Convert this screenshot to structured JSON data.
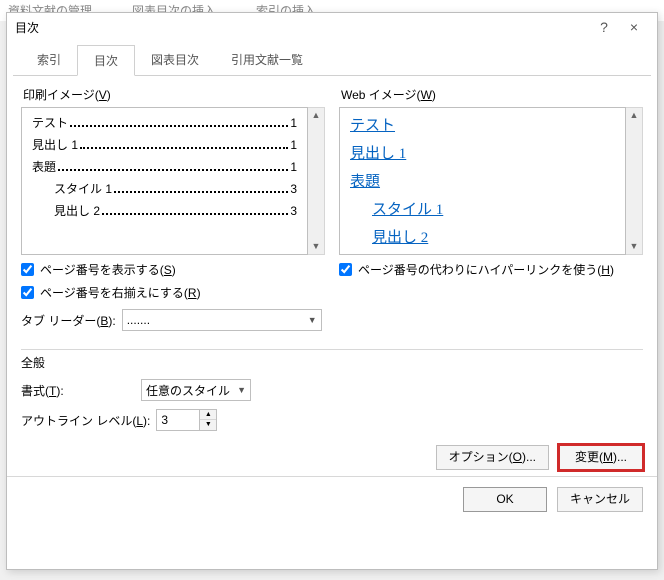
{
  "bg": {
    "a": "資料文献の管理",
    "b": "図表目次の挿入",
    "c": "索引の挿入"
  },
  "titlebar": {
    "title": "目次",
    "help": "?",
    "close": "×"
  },
  "tabs": {
    "t0": "索引",
    "t1": "目次",
    "t2": "図表目次",
    "t3": "引用文献一覧"
  },
  "print": {
    "label_pre": "印刷イメージ(",
    "label_key": "V",
    "label_post": ")",
    "lines": [
      {
        "text": "テスト",
        "page": "1",
        "indent": 0
      },
      {
        "text": "見出し 1",
        "page": "1",
        "indent": 0
      },
      {
        "text": "表題",
        "page": "1",
        "indent": 0
      },
      {
        "text": "スタイル 1",
        "page": "3",
        "indent": 1
      },
      {
        "text": "見出し 2",
        "page": "3",
        "indent": 1
      }
    ]
  },
  "web": {
    "label_pre": "Web イメージ(",
    "label_key": "W",
    "label_post": ")",
    "lines": [
      {
        "text": "テスト",
        "indent": 0
      },
      {
        "text": "見出し 1",
        "indent": 0
      },
      {
        "text": "表題",
        "indent": 0
      },
      {
        "text": "スタイル 1",
        "indent": 1
      },
      {
        "text": "見出し 2",
        "indent": 1
      }
    ]
  },
  "checks": {
    "show_pg_pre": "ページ番号を表示する(",
    "show_pg_key": "S",
    "show_pg_post": ")",
    "right_pg_pre": "ページ番号を右揃えにする(",
    "right_pg_key": "R",
    "right_pg_post": ")",
    "hyper_pre": "ページ番号の代わりにハイパーリンクを使う(",
    "hyper_key": "H",
    "hyper_post": ")"
  },
  "tab_leader": {
    "label_pre": "タブ リーダー(",
    "label_key": "B",
    "label_post": "):",
    "value": "......."
  },
  "general": {
    "heading": "全般",
    "format_pre": "書式(",
    "format_key": "T",
    "format_post": "):",
    "format_value": "任意のスタイル",
    "outline_pre": "アウトライン レベル(",
    "outline_key": "L",
    "outline_post": "):",
    "outline_value": "3"
  },
  "buttons": {
    "options_pre": "オプション(",
    "options_key": "O",
    "options_post": ")...",
    "modify_pre": "変更(",
    "modify_key": "M",
    "modify_post": ")...",
    "ok": "OK",
    "cancel": "キャンセル"
  }
}
